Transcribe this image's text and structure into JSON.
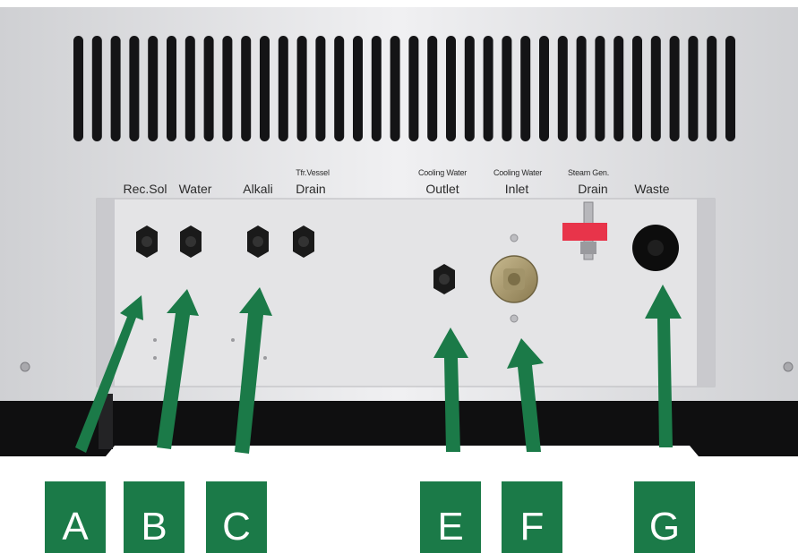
{
  "panel_labels": {
    "rec_sol": "Rec.Sol",
    "water": "Water",
    "alkali": "Alkali",
    "tfr_vessel": "Tfr.Vessel",
    "drain": "Drain",
    "cooling_water_outlet_top": "Cooling Water",
    "outlet": "Outlet",
    "cooling_water_inlet_top": "Cooling Water",
    "inlet": "Inlet",
    "steam_gen": "Steam Gen.",
    "steam_drain": "Drain",
    "waste": "Waste"
  },
  "badges": [
    "A",
    "B",
    "C",
    "E",
    "F",
    "G"
  ],
  "colors": {
    "badge": "#1b7a48",
    "arrow": "#1b7a48",
    "clamp": "#e8344a",
    "panel": "#e4e4e6"
  },
  "icons": [
    "vent-slots",
    "hex-fitting-icon",
    "brass-fitting-icon",
    "drain-valve-icon",
    "waste-port-icon",
    "arrow-icon"
  ]
}
